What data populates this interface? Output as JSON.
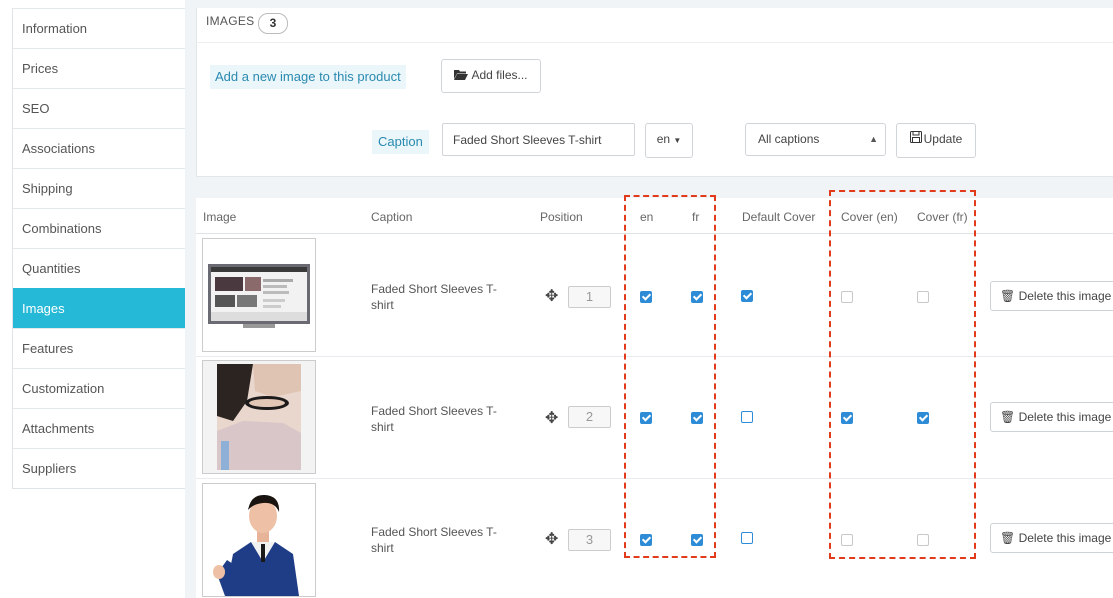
{
  "sidebar": {
    "items": [
      {
        "label": "Information"
      },
      {
        "label": "Prices"
      },
      {
        "label": "SEO"
      },
      {
        "label": "Associations"
      },
      {
        "label": "Shipping"
      },
      {
        "label": "Combinations"
      },
      {
        "label": "Quantities"
      },
      {
        "label": "Images",
        "active": true
      },
      {
        "label": "Features"
      },
      {
        "label": "Customization"
      },
      {
        "label": "Attachments"
      },
      {
        "label": "Suppliers"
      }
    ]
  },
  "panel": {
    "heading": "IMAGES",
    "count": "3",
    "add_image_label": "Add a new image to this product",
    "add_files_button": "Add files...",
    "caption_label": "Caption",
    "caption_value": "Faded Short Sleeves T-shirt",
    "language": "en",
    "captions_select": "All captions",
    "update_button": "Update"
  },
  "table": {
    "headers": {
      "image": "Image",
      "caption": "Caption",
      "position": "Position",
      "en": "en",
      "fr": "fr",
      "default_cover": "Default Cover",
      "cover_en": "Cover (en)",
      "cover_fr": "Cover (fr)"
    },
    "rows": [
      {
        "caption": "Faded Short Sleeves T-shirt",
        "position": "1",
        "en": true,
        "fr": true,
        "default_cover": true,
        "cover_en": false,
        "cover_fr": false,
        "delete_label": "Delete this image"
      },
      {
        "caption": "Faded Short Sleeves T-shirt",
        "position": "2",
        "en": true,
        "fr": true,
        "default_cover": false,
        "cover_en": true,
        "cover_fr": true,
        "delete_label": "Delete this image"
      },
      {
        "caption": "Faded Short Sleeves T-shirt",
        "position": "3",
        "en": true,
        "fr": true,
        "default_cover": false,
        "cover_en": false,
        "cover_fr": false,
        "delete_label": "Delete this image"
      }
    ]
  },
  "colors": {
    "accent": "#25b9d7",
    "checkbox": "#2e8cd7",
    "highlight": "#e23b1c"
  }
}
